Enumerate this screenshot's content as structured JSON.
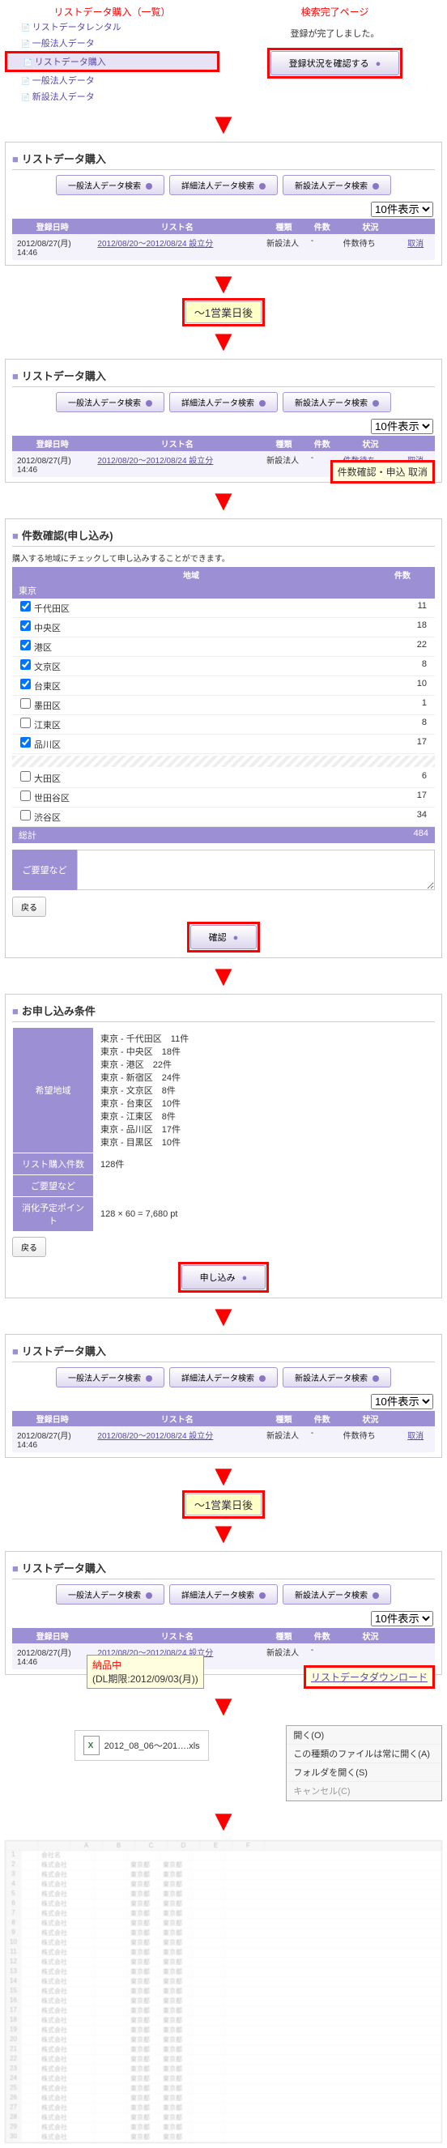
{
  "top": {
    "left_title": "リストデータ購入（一覧）",
    "right_title": "検索完了ページ",
    "reg_done": "登録が完了しました。",
    "check_btn": "登録状況を確認する",
    "nav": [
      "リストデータレンタル",
      "一般法人データ",
      "リストデータ購入",
      "一般法人データ",
      "新設法人データ"
    ]
  },
  "list_panel": {
    "title": "リストデータ購入",
    "btns": [
      "一般法人データ検索",
      "詳細法人データ検索",
      "新設法人データ検索"
    ],
    "sel": "10件表示",
    "hdr": [
      "登録日時",
      "リスト名",
      "種類",
      "件数",
      "状況",
      ""
    ],
    "row1": [
      "2012/08/27(月) 14:46",
      "2012/08/20～2012/08/24 設立分",
      "新設法人",
      "-",
      "件数待ち",
      "取消"
    ]
  },
  "day_label": "～1営業日後",
  "tooltip": "件数確認・申込 取消",
  "count_panel": {
    "title": "件数確認(申し込み)",
    "desc": "購入する地域にチェックして申し込みすることができます。",
    "reg_hdr": [
      "地域",
      "件数"
    ],
    "pref": "東京",
    "rows": [
      {
        "c": true,
        "n": "千代田区",
        "v": "11"
      },
      {
        "c": true,
        "n": "中央区",
        "v": "18"
      },
      {
        "c": true,
        "n": "港区",
        "v": "22"
      },
      {
        "c": true,
        "n": "文京区",
        "v": "8"
      },
      {
        "c": true,
        "n": "台東区",
        "v": "10"
      },
      {
        "c": false,
        "n": "墨田区",
        "v": "1"
      },
      {
        "c": false,
        "n": "江東区",
        "v": "8"
      },
      {
        "c": true,
        "n": "品川区",
        "v": "17"
      },
      {
        "c": false,
        "n": "大田区",
        "v": "6"
      },
      {
        "c": false,
        "n": "世田谷区",
        "v": "17"
      },
      {
        "c": false,
        "n": "渋谷区",
        "v": "34"
      }
    ],
    "total_label": "総計",
    "total": "484",
    "req_label": "ご要望など",
    "back": "戻る",
    "confirm": "確認"
  },
  "cond_panel": {
    "title": "お申し込み条件",
    "area_lbl": "希望地域",
    "areas": [
      "東京 - 千代田区　11件",
      "東京 - 中央区　18件",
      "東京 - 港区　22件",
      "東京 - 新宿区　24件",
      "東京 - 文京区　8件",
      "東京 - 台東区　10件",
      "東京 - 江東区　8件",
      "東京 - 品川区　17件",
      "東京 - 目黒区　10件"
    ],
    "count_lbl": "リスト購入件数",
    "count": "128件",
    "req_lbl": "ご要望など",
    "pt_lbl": "消化予定ポイント",
    "pt": "128 × 60 = 7,680 pt",
    "back": "戻る",
    "submit": "申し込み"
  },
  "dl": {
    "status": "納品中",
    "due": "(DL期限:2012/09/03(月))",
    "btn": "リストデータダウンロード",
    "file": "2012_08_06～201….xls",
    "menu": [
      "開く(O)",
      "この種類のファイルは常に開く(A)",
      "フォルダを開く(S)",
      "キャンセル(C)"
    ]
  },
  "excel": {
    "cols": [
      "A",
      "B",
      "C",
      "D",
      "E",
      "F"
    ],
    "rep": [
      "株式会社",
      "東京都",
      "東京都"
    ]
  }
}
